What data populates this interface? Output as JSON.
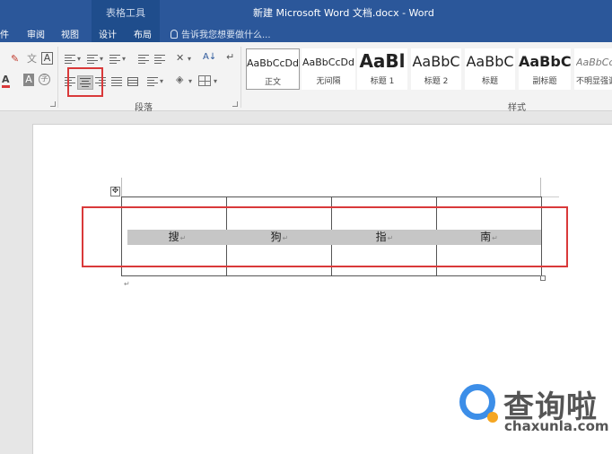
{
  "window": {
    "context_group": "表格工具",
    "title": "新建 Microsoft Word 文档.docx - Word"
  },
  "tabs": [
    "件",
    "审阅",
    "视图",
    "设计",
    "布局"
  ],
  "tell_me": "告诉我您想要做什么...",
  "ribbon": {
    "font_glyphs": {
      "clear": "A",
      "phonetic": "文",
      "box": "A",
      "color": "A",
      "shade": "A"
    },
    "groups": {
      "paragraph": "段落",
      "styles": "样式"
    },
    "styles": [
      {
        "sample": "AaBbCcDd",
        "name": "正文",
        "active": true
      },
      {
        "sample": "AaBbCcDd",
        "name": "无间隔",
        "active": false
      },
      {
        "sample": "AaBl",
        "name": "标题 1",
        "active": false
      },
      {
        "sample": "AaBbC",
        "name": "标题 2",
        "active": false
      },
      {
        "sample": "AaBbC",
        "name": "标题",
        "active": false
      },
      {
        "sample": "AaBbC",
        "name": "副标题",
        "active": false
      },
      {
        "sample": "AaBbCcD",
        "name": "不明显强调",
        "active": false
      }
    ]
  },
  "document": {
    "table": {
      "rows": [
        [
          "搜",
          "狗",
          "指",
          "南"
        ]
      ]
    },
    "paragraph_mark": "↵"
  },
  "watermark": {
    "text": "查询啦",
    "url": "chaxunla.com"
  },
  "colors": {
    "title_bar": "#2b579a",
    "highlight": "#d9393a",
    "cell_shading": "#c6c6c6"
  }
}
